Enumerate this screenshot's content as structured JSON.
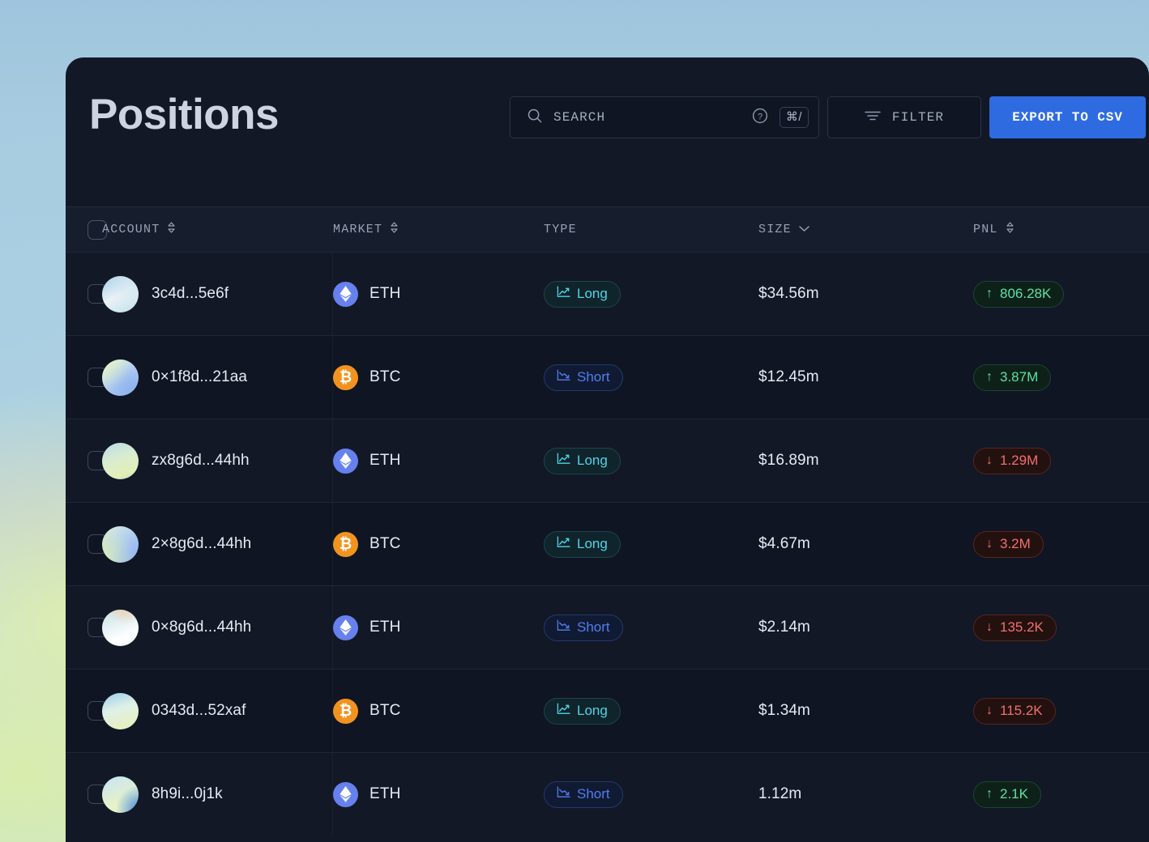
{
  "header": {
    "title": "Positions",
    "search": {
      "placeholder": "SEARCH",
      "value": "",
      "shortcut": "⌘/"
    },
    "filter_label": "FILTER",
    "export_label": "EXPORT TO CSV"
  },
  "table": {
    "columns": [
      {
        "key": "account",
        "label": "ACCOUNT",
        "sort": "both"
      },
      {
        "key": "market",
        "label": "MARKET",
        "sort": "both"
      },
      {
        "key": "type",
        "label": "TYPE",
        "sort": "none"
      },
      {
        "key": "size",
        "label": "SIZE",
        "sort": "desc"
      },
      {
        "key": "pnl",
        "label": "PNL",
        "sort": "both"
      }
    ],
    "rows": [
      {
        "account": "3c4d...5e6f",
        "market": "ETH",
        "type": "Long",
        "size": "$34.56m",
        "pnl": "806.28K",
        "pnl_dir": "up"
      },
      {
        "account": "0×1f8d...21aa",
        "market": "BTC",
        "type": "Short",
        "size": "$12.45m",
        "pnl": "3.87M",
        "pnl_dir": "up"
      },
      {
        "account": "zx8g6d...44hh",
        "market": "ETH",
        "type": "Long",
        "size": "$16.89m",
        "pnl": "1.29M",
        "pnl_dir": "down"
      },
      {
        "account": "2×8g6d...44hh",
        "market": "BTC",
        "type": "Long",
        "size": "$4.67m",
        "pnl": "3.2M",
        "pnl_dir": "down"
      },
      {
        "account": "0×8g6d...44hh",
        "market": "ETH",
        "type": "Short",
        "size": "$2.14m",
        "pnl": "135.2K",
        "pnl_dir": "down"
      },
      {
        "account": "0343d...52xaf",
        "market": "BTC",
        "type": "Long",
        "size": "$1.34m",
        "pnl": "115.2K",
        "pnl_dir": "down"
      },
      {
        "account": "8h9i...0j1k",
        "market": "ETH",
        "type": "Short",
        "size": "1.12m",
        "pnl": "2.1K",
        "pnl_dir": "up"
      }
    ]
  },
  "colors": {
    "accent": "#2f6be0",
    "panel": "#121826",
    "long": "#4fd4e8",
    "short": "#4f7ef0",
    "pnl_up": "#5fe0a4",
    "pnl_down": "#f07070",
    "eth": "#6680ee",
    "btc": "#f2931f"
  }
}
